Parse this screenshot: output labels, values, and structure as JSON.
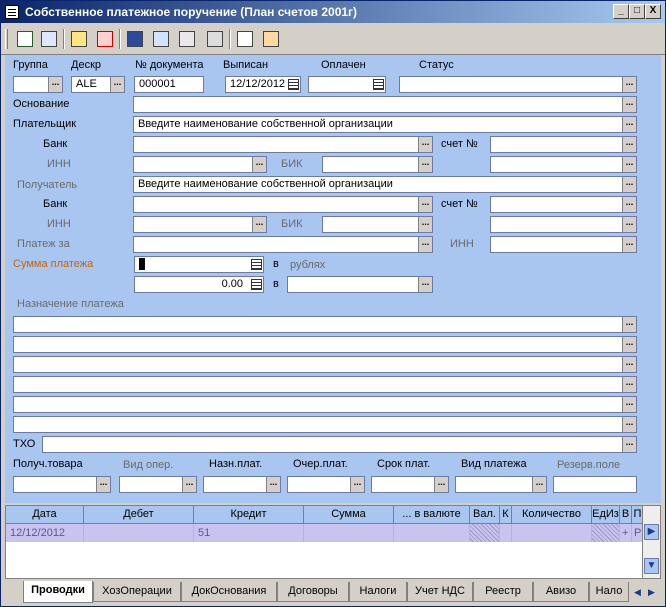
{
  "window": {
    "title": "Собственное платежное поручение (План счетов 2001г)"
  },
  "titlebar_buttons": {
    "minimize": "_",
    "maximize": "□",
    "close": "X"
  },
  "toolbar": {
    "tools": [
      "tool-1-icon",
      "tool-2-icon",
      "tool-3-icon",
      "tool-4-icon",
      "save-icon",
      "tool-6-icon",
      "tool-7-icon",
      "tool-8-icon",
      "tool-9-icon",
      "tool-10-icon"
    ]
  },
  "header": {
    "labels": {
      "group": "Группа",
      "desc": "Дескр",
      "doc_no": "№ документа",
      "issued": "Выписан",
      "paid": "Оплачен",
      "status": "Статус"
    },
    "values": {
      "group": "",
      "desc": "ALE",
      "doc_no": "000001",
      "issued": "12/12/2012",
      "paid": "",
      "status": ""
    }
  },
  "labels": {
    "basis": "Основание",
    "payer": "Плательщик",
    "bank": "Банк",
    "inn": "ИНН",
    "bik": "БИК",
    "account_no": "счет №",
    "recipient": "Получатель",
    "payment_for": "Платеж за",
    "amount": "Сумма платежа",
    "in_label": "в",
    "rubles": "рублях",
    "purpose": "Назначение платежа",
    "tho": "ТХО"
  },
  "values": {
    "payer_org": "Введите наименование собственной организации",
    "recipient_org": "Введите наименование собственной организации",
    "amount2": "0.00"
  },
  "bottom": {
    "labels": {
      "goods_recipient": "Получ.товара",
      "op_type": "Вид опер.",
      "purpose_pay": "Назн.плат.",
      "order": "Очер.плат.",
      "term": "Срок плат.",
      "pay_type": "Вид платежа",
      "reserve": "Резерв.поле"
    }
  },
  "grid": {
    "columns": [
      "Дата",
      "Дебет",
      "Кредит",
      "Сумма",
      "... в валюте",
      "Вал.",
      "К",
      "Количество",
      "ЕдИз",
      "В",
      "П"
    ],
    "row": [
      "12/12/2012",
      "",
      "51",
      "",
      "",
      "",
      "",
      "",
      "",
      "+",
      "P"
    ]
  },
  "tabs": [
    "Проводки",
    "ХозОперации",
    "ДокОснования",
    "Договоры",
    "Налоги",
    "Учет НДС",
    "Реестр",
    "Авизо",
    "Нало"
  ],
  "scroll": {
    "up": "▲",
    "down": "▼",
    "left": "◀",
    "right": "▶"
  },
  "glyphs": {
    "ellipsis": "...",
    "cal": "▦"
  }
}
